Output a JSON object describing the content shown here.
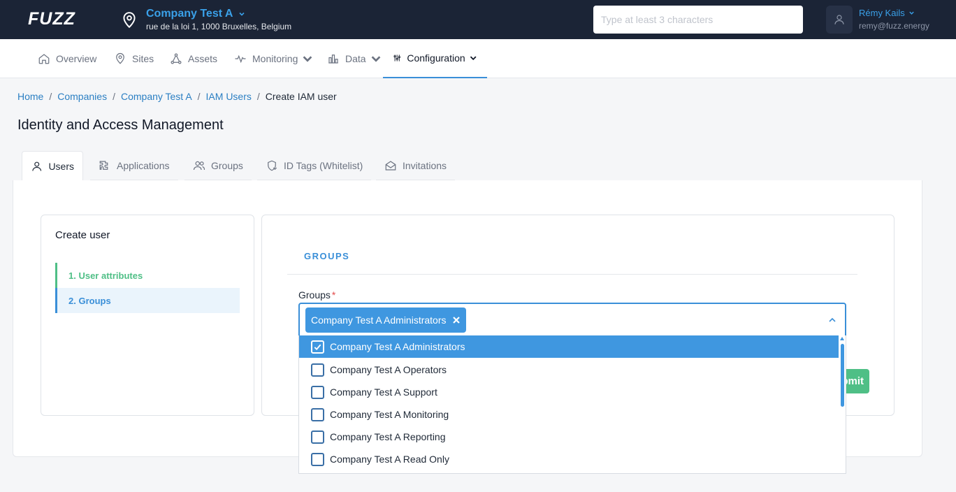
{
  "topbar": {
    "logo": "FUZZ",
    "company_name": "Company Test A",
    "company_address": "rue de la loi 1, 1000 Bruxelles, Belgium",
    "search_placeholder": "Type at least 3 characters",
    "user_name": "Rémy Kails",
    "user_email": "remy@fuzz.energy"
  },
  "nav": {
    "items": [
      {
        "label": "Overview",
        "icon": "home-icon"
      },
      {
        "label": "Sites",
        "icon": "location-pin-icon"
      },
      {
        "label": "Assets",
        "icon": "assets-network-icon"
      },
      {
        "label": "Monitoring",
        "icon": "pulse-icon"
      },
      {
        "label": "Data",
        "icon": "bar-chart-icon"
      },
      {
        "label": "Configuration",
        "icon": "sliders-icon",
        "active": true
      }
    ]
  },
  "breadcrumb": [
    "Home",
    "Companies",
    "Company Test A",
    "IAM Users",
    "Create IAM user"
  ],
  "page_title": "Identity and Access Management",
  "tabs": [
    {
      "label": "Users",
      "icon": "user-icon",
      "active": true
    },
    {
      "label": "Applications",
      "icon": "puzzle-icon"
    },
    {
      "label": "Groups",
      "icon": "users-icon"
    },
    {
      "label": "ID Tags (Whitelist)",
      "icon": "tag-shield-icon"
    },
    {
      "label": "Invitations",
      "icon": "envelope-icon"
    }
  ],
  "steps": {
    "title": "Create user",
    "items": [
      "1. User attributes",
      "2. Groups"
    ],
    "active_index": 1
  },
  "form": {
    "section_title": "GROUPS",
    "field_label": "Groups",
    "required_mark": "*",
    "submit_label": "Submit",
    "selected_chip": "Company Test A Administrators",
    "options": [
      {
        "label": "Company Test A Administrators",
        "checked": true
      },
      {
        "label": "Company Test A Operators",
        "checked": false
      },
      {
        "label": "Company Test A Support",
        "checked": false
      },
      {
        "label": "Company Test A Monitoring",
        "checked": false
      },
      {
        "label": "Company Test A Reporting",
        "checked": false
      },
      {
        "label": "Company Test A Read Only",
        "checked": false
      }
    ]
  },
  "colors": {
    "topbar_bg": "#1b2436",
    "accent": "#3a8fd8",
    "success": "#4fbf86"
  }
}
